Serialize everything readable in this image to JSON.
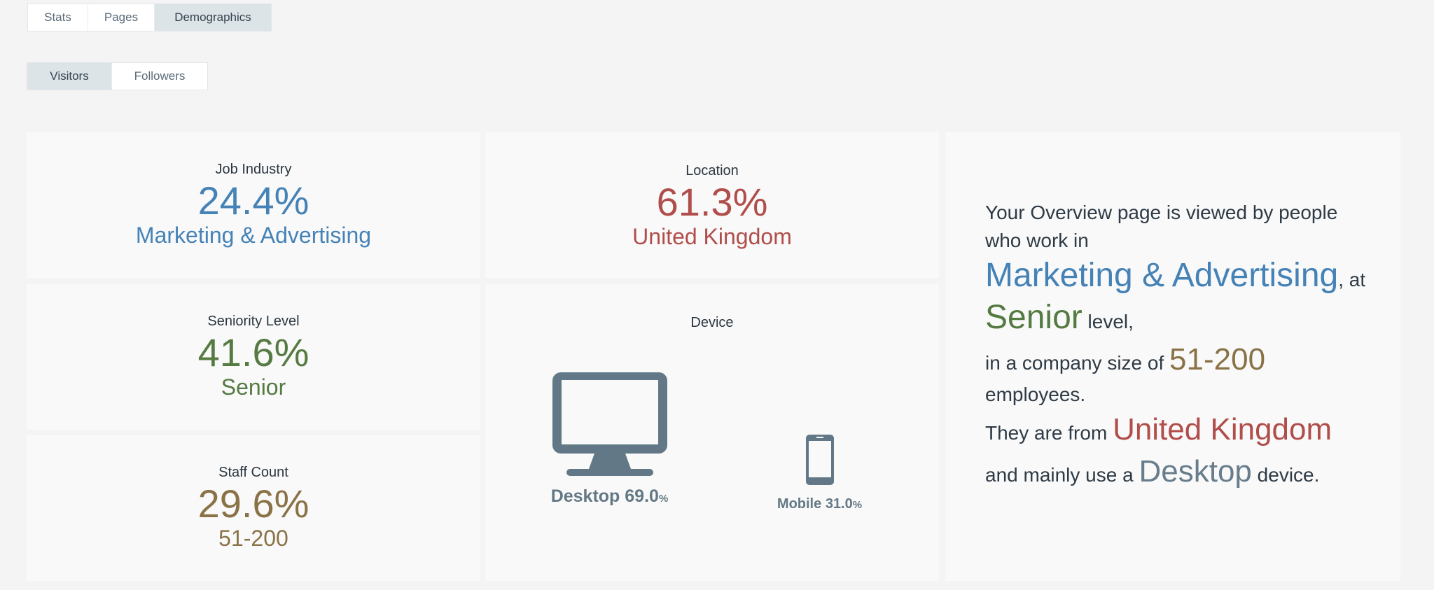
{
  "tabs_top": [
    "Stats",
    "Pages",
    "Demographics"
  ],
  "tabs_sub": [
    "Visitors",
    "Followers"
  ],
  "cards": {
    "industry": {
      "label": "Job Industry",
      "percent": "24.4%",
      "value": "Marketing & Advertising",
      "color": "#4582b6"
    },
    "seniority": {
      "label": "Seniority Level",
      "percent": "41.6%",
      "value": "Senior",
      "color": "#557b42"
    },
    "staff": {
      "label": "Staff Count",
      "percent": "29.6%",
      "value": "51-200",
      "color": "#8a7247"
    },
    "location": {
      "label": "Location",
      "percent": "61.3%",
      "value": "United Kingdom",
      "color": "#b04e4b"
    },
    "device": {
      "label": "Device",
      "desktop": {
        "name": "Desktop",
        "percent": "69.0",
        "icon": "desktop-monitor-icon"
      },
      "mobile": {
        "name": "Mobile",
        "percent": "31.0",
        "icon": "mobile-phone-icon"
      },
      "percent_sign": "%",
      "color": "#637885"
    }
  },
  "overview": {
    "line1": "Your Overview page is viewed by people who work in",
    "industry": "Marketing & Advertising",
    "after_industry": ", at",
    "seniority": "Senior",
    "after_seniority": " level,",
    "before_size": "in a company size of ",
    "size": "51-200",
    "after_size": "employees.",
    "before_location": "They are from ",
    "location": "United Kingdom",
    "before_device": "and mainly use a ",
    "device": "Desktop",
    "after_device": " device."
  }
}
